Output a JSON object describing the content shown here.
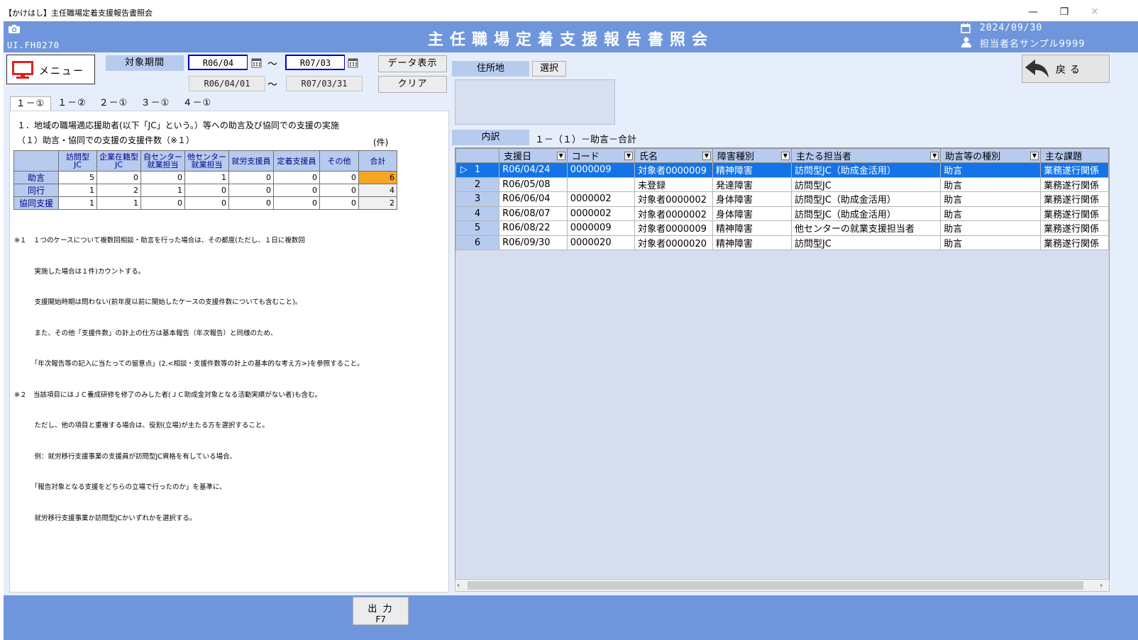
{
  "window": {
    "title": "【かけはし】主任職場定着支援報告書照会",
    "minimize": "—",
    "restore": "❐",
    "close": "✕"
  },
  "header": {
    "app_title": "主任職場定着支援報告書照会",
    "screen_id": "UI.FH0270",
    "date": "2024/09/30",
    "user": "担当者名サンプル9999"
  },
  "toolbar": {
    "menu_label": "メニュー",
    "period_label": "対象期間",
    "from": "R06/04",
    "to": "R07/03",
    "tilde": "～",
    "from_full": "R06/04/01",
    "to_full": "R07/03/31",
    "display_label": "データ表示",
    "clear_label": "クリア",
    "address_label": "住所地",
    "select_label": "選択",
    "back_label": "戻る"
  },
  "tabs": [
    {
      "label": "１－①"
    },
    {
      "label": "１－②"
    },
    {
      "label": "２－①"
    },
    {
      "label": "３－①"
    },
    {
      "label": "４－①"
    }
  ],
  "left_panel": {
    "heading1": "１．地域の職場適応援助者(以下「JC」という。）等への助言及び協同での支援の実施",
    "heading2": "（１）助言・協同での支援の支援件数（※１）",
    "unit": "(件)",
    "columns": [
      "訪問型\nJC",
      "企業在籍型\nJC",
      "自センター\n就業担当",
      "他センター\n就業担当",
      "就労支援員",
      "定着支援員",
      "その他",
      "合計"
    ],
    "rows": [
      {
        "label": "助言",
        "values": [
          "5",
          "0",
          "0",
          "1",
          "0",
          "0",
          "0",
          "6"
        ]
      },
      {
        "label": "同行",
        "values": [
          "1",
          "2",
          "1",
          "0",
          "0",
          "0",
          "0",
          "4"
        ]
      },
      {
        "label": "協同支援",
        "values": [
          "1",
          "1",
          "0",
          "0",
          "0",
          "0",
          "0",
          "2"
        ]
      }
    ],
    "notes": [
      "※１　１つのケースについて複数回相談・助言を行った場合は、その都度(ただし、１日に複数回",
      "　　　実施した場合は１件)カウントする。",
      "　　　支援開始時期は問わない(前年度以前に開始したケースの支援件数についても含むこと)。",
      "　　　また、その他「支援件数」の計上の仕方は基本報告（年次報告）と同様のため、",
      "　　　「年次報告等の記入に当たっての留意点」(2.<相談・支援件数等の計上の基本的な考え方>)を参照すること。",
      "※２　当該項目にはＪＣ養成研修を修了のみした者(ＪＣ助成金対象となる活動実績がない者)も含む。",
      "　　　ただし、他の項目と重複する場合は、役割(立場)が主たる方を選択すること。",
      "　　　例：就労移行支援事業の支援員が訪問型JC資格を有している場合、",
      "　　　「報告対象となる支援をどちらの立場で行ったのか」を基準に、",
      "　　　就労移行支援事業か訪問型JCかいずれかを選択する。"
    ]
  },
  "right_panel": {
    "breakdown_label": "内訳",
    "breakdown_value": "１－（１）－助言－合計",
    "columns": [
      "",
      "支援日",
      "コード",
      "氏名",
      "障害種別",
      "主たる担当者",
      "助言等の種別",
      "主な課題"
    ],
    "rows": [
      [
        "1",
        "R06/04/24",
        "0000009",
        "対象者0000009",
        "精神障害",
        "訪問型JC（助成金活用）",
        "助言",
        "業務遂行関係"
      ],
      [
        "2",
        "R06/05/08",
        "",
        "未登録",
        "発達障害",
        "訪問型JC",
        "助言",
        "業務遂行関係"
      ],
      [
        "3",
        "R06/06/04",
        "0000002",
        "対象者0000002",
        "身体障害",
        "訪問型JC（助成金活用）",
        "助言",
        "業務遂行関係"
      ],
      [
        "4",
        "R06/08/07",
        "0000002",
        "対象者0000002",
        "身体障害",
        "訪問型JC（助成金活用）",
        "助言",
        "業務遂行関係"
      ],
      [
        "5",
        "R06/08/22",
        "0000009",
        "対象者0000009",
        "精神障害",
        "他センターの就業支援担当者",
        "助言",
        "業務遂行関係"
      ],
      [
        "6",
        "R06/09/30",
        "0000020",
        "対象者0000020",
        "精神障害",
        "訪問型JC",
        "助言",
        "業務遂行関係"
      ]
    ]
  },
  "footer": {
    "output_label": "出 力",
    "output_key": "F7"
  },
  "colors": {
    "header_blue": "#6f96dc",
    "label_blue": "#b7cbef",
    "selected_row": "#1473e6",
    "total_highlight": "#f5a623"
  }
}
